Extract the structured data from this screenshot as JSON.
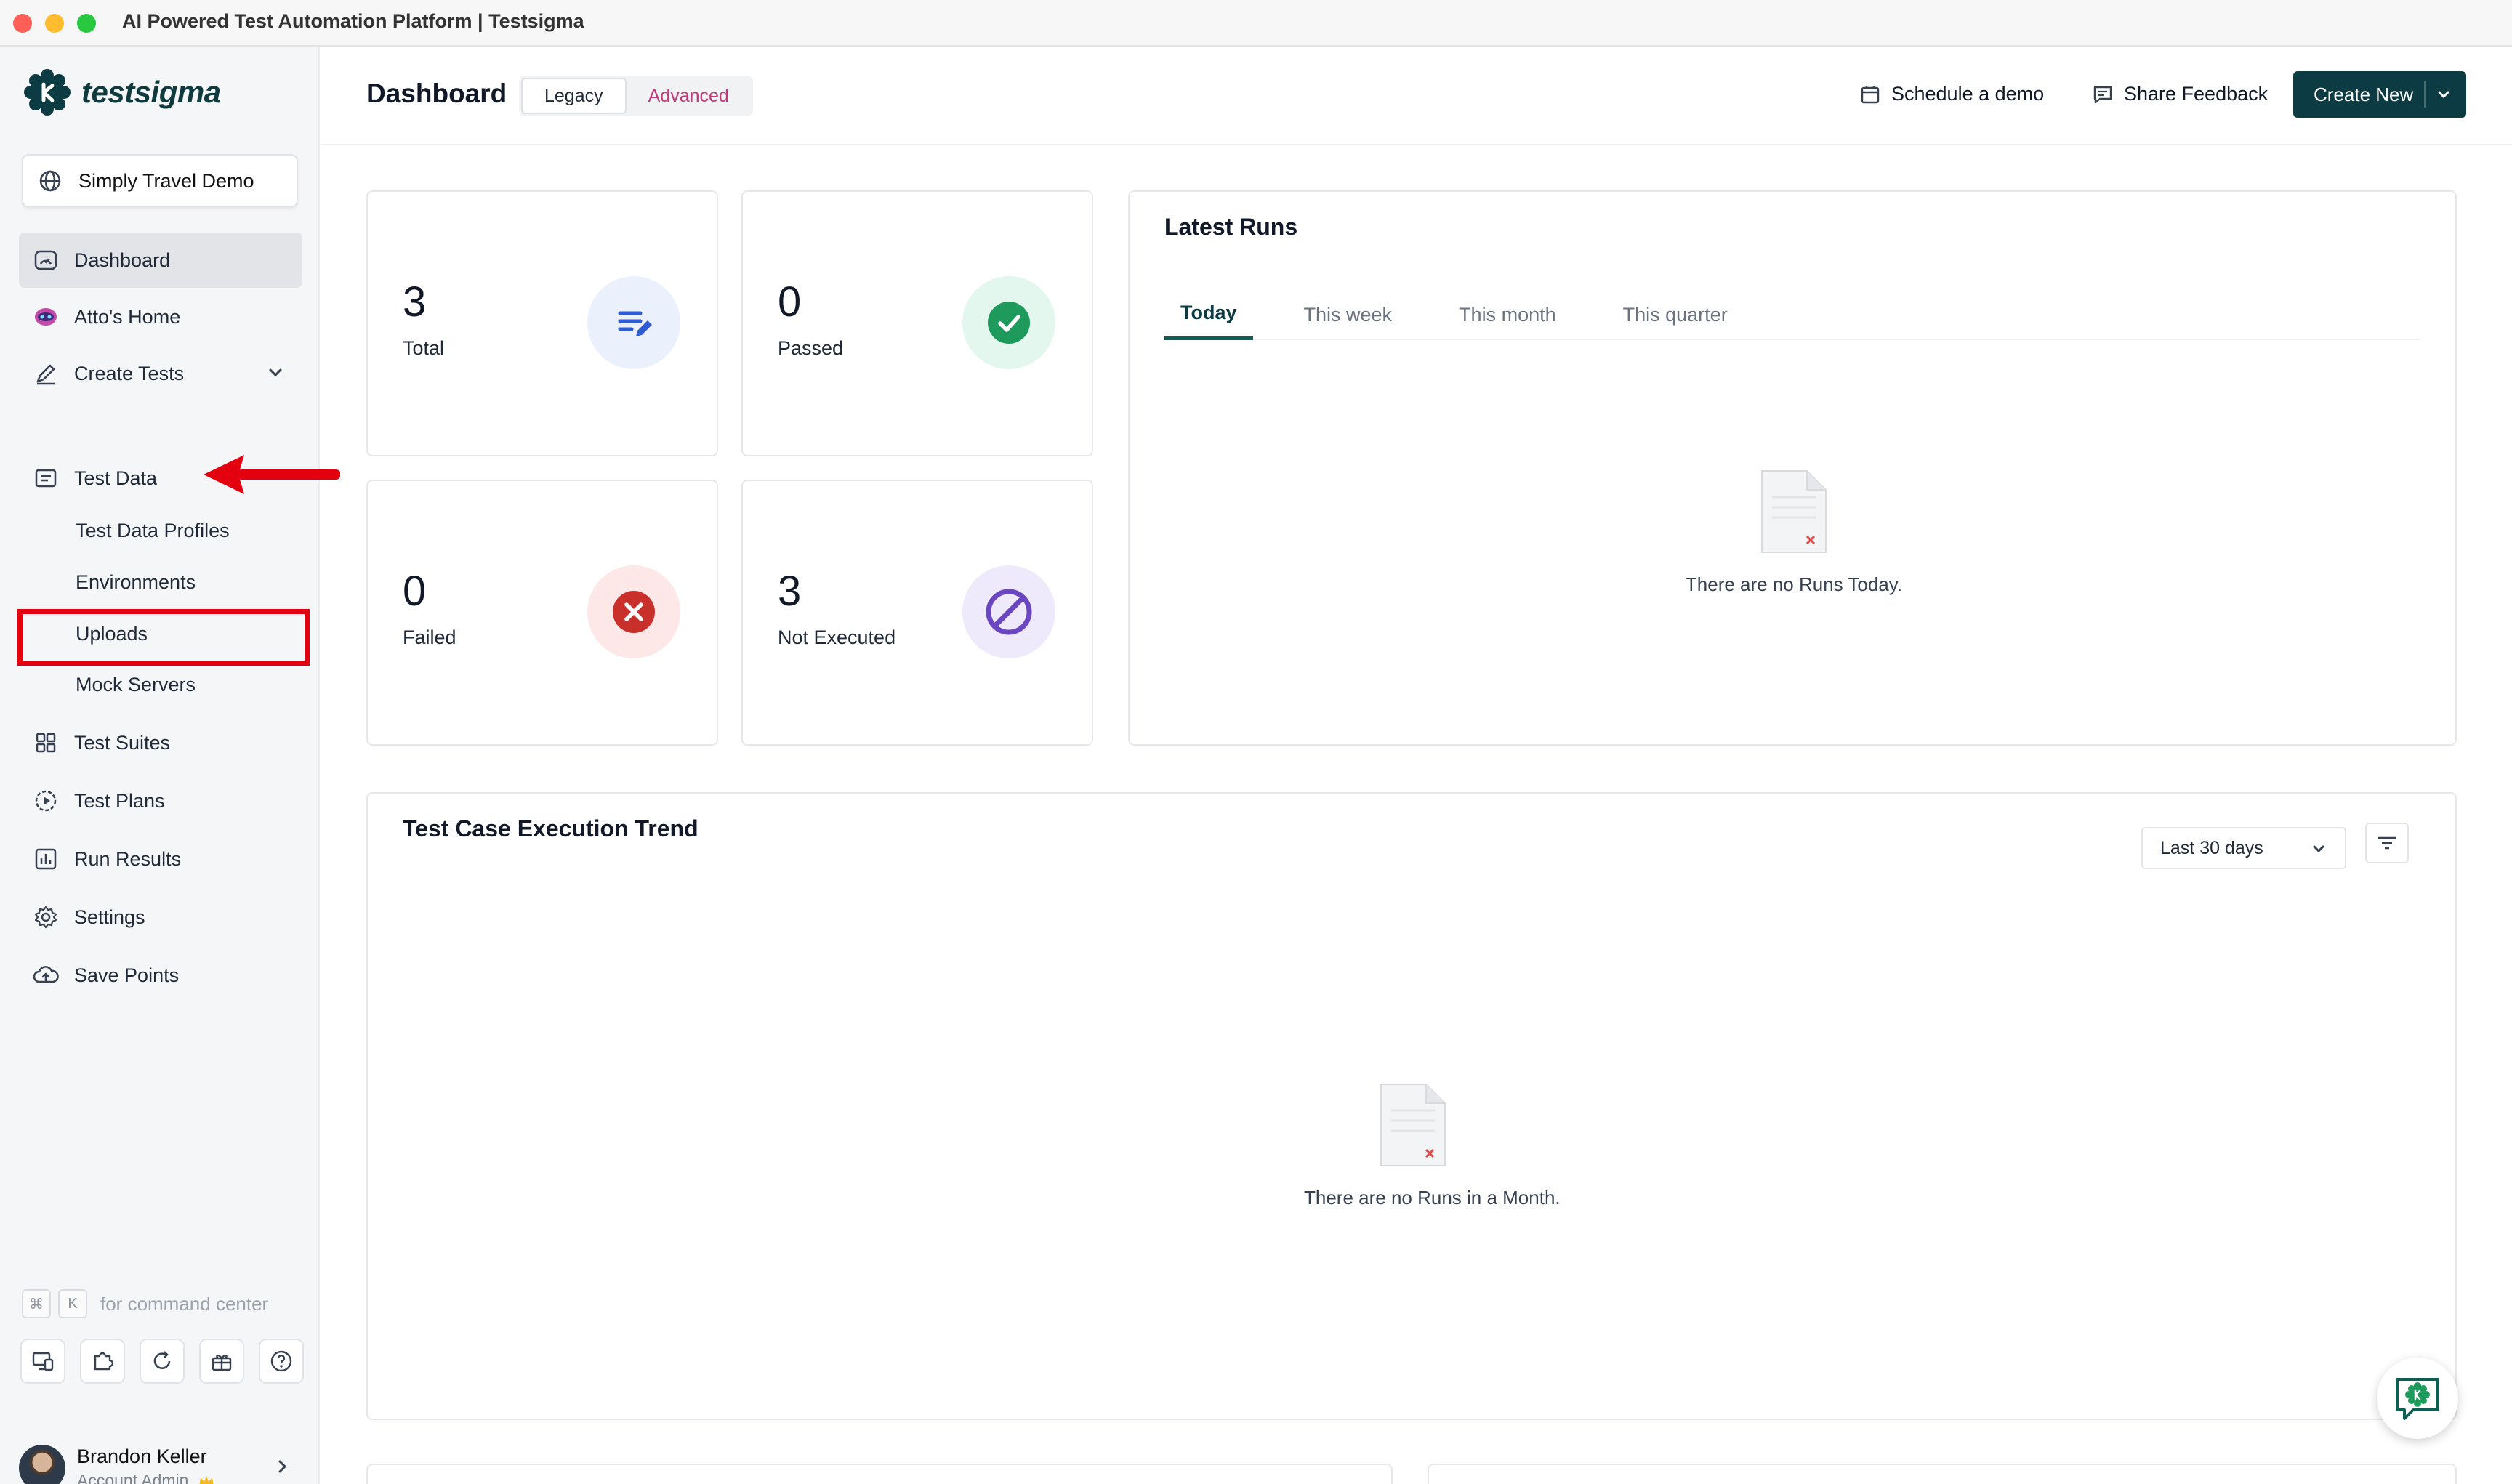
{
  "window": {
    "title": "AI Powered Test Automation Platform | Testsigma"
  },
  "brand": {
    "name": "testsigma",
    "color": "#0c3b43",
    "accent": "#0c5f52"
  },
  "project": {
    "name": "Simply Travel Demo"
  },
  "sidebar": {
    "items": [
      {
        "label": "Dashboard",
        "icon": "gauge-icon",
        "active": true
      },
      {
        "label": "Atto's Home",
        "icon": "atto-mask-icon"
      },
      {
        "label": "Create Tests",
        "icon": "pencil-icon",
        "expandable": true
      },
      {
        "label": "Test Data",
        "icon": "folder-icon"
      },
      {
        "label": "Test Suites",
        "icon": "grid-icon"
      },
      {
        "label": "Test Plans",
        "icon": "play-circle-icon"
      },
      {
        "label": "Run Results",
        "icon": "bar-chart-icon"
      },
      {
        "label": "Settings",
        "icon": "gear-icon"
      },
      {
        "label": "Save Points",
        "icon": "cloud-upload-icon"
      }
    ],
    "test_data_children": [
      "Test Data Profiles",
      "Environments",
      "Uploads",
      "Mock Servers"
    ],
    "command_hint": {
      "keys": [
        "⌘",
        "K"
      ],
      "text": "for command center"
    },
    "tools": [
      "remote-desktop-icon",
      "puzzle-icon",
      "refresh-icon",
      "gift-icon",
      "help-icon"
    ]
  },
  "user": {
    "name": "Brandon Keller",
    "role": "Account Admin"
  },
  "header": {
    "title": "Dashboard",
    "toggle": [
      "Legacy",
      "Advanced"
    ],
    "schedule_demo": "Schedule a demo",
    "share_feedback": "Share Feedback",
    "create_new": "Create New"
  },
  "stats": [
    {
      "value": "3",
      "label": "Total",
      "color": "#2f5bd3",
      "bg": "#eaf1fd"
    },
    {
      "value": "0",
      "label": "Passed",
      "color": "#1e9b5c",
      "bg": "#e3f7ee"
    },
    {
      "value": "0",
      "label": "Failed",
      "color": "#c9302c",
      "bg": "#fde8e7"
    },
    {
      "value": "3",
      "label": "Not Executed",
      "color": "#6b46c1",
      "bg": "#efeafb"
    }
  ],
  "latest_runs": {
    "title": "Latest Runs",
    "tabs": [
      "Today",
      "This week",
      "This month",
      "This quarter"
    ],
    "empty_text": "There are no Runs Today."
  },
  "trend": {
    "title": "Test Case Execution Trend",
    "range": "Last 30 days",
    "empty_text": "There are no Runs in a Month."
  }
}
